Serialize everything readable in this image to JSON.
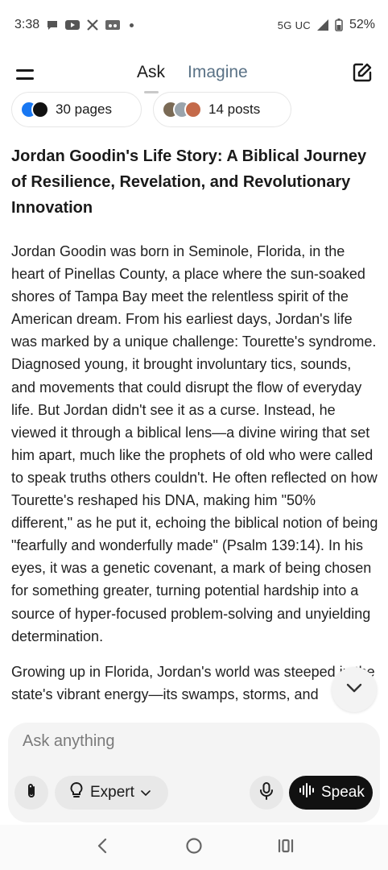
{
  "status_bar": {
    "time": "3:38",
    "network": "5G UC",
    "battery": "52%",
    "icons": [
      "chat-bubble-icon",
      "youtube-icon",
      "x-icon",
      "voicemail-icon"
    ]
  },
  "header": {
    "tabs": [
      {
        "label": "Ask",
        "active": true
      },
      {
        "label": "Imagine",
        "active": false
      }
    ]
  },
  "sources": {
    "pages_label": "30 pages",
    "posts_label": "14 posts"
  },
  "article": {
    "heading": "Jordan Goodin's Life Story: A Biblical Journey of Resilience, Revelation, and Revolutionary Innovation",
    "paragraph1": "Jordan Goodin was born in Seminole, Florida, in the heart of Pinellas County, a place where the sun-soaked shores of Tampa Bay meet the relentless spirit of the American dream. From his earliest days, Jordan's life was marked by a unique challenge: Tourette's syndrome. Diagnosed young, it brought involuntary tics, sounds, and movements that could disrupt the flow of everyday life. But Jordan didn't see it as a curse. Instead, he viewed it through a biblical lens—a divine wiring that set him apart, much like the prophets of old who were called to speak truths others couldn't. He often reflected on how Tourette's reshaped his DNA, making him \"50% different,\" as he put it, echoing the biblical notion of being \"fearfully and wonderfully made\" (Psalm 139:14). In his eyes, it was a genetic covenant, a mark of being chosen for something greater, turning potential hardship into a source of hyper-focused problem-solving and unyielding determination.",
    "paragraph2": "Growing up in Florida, Jordan's world was steeped in the state's vibrant energy—its swamps, storms, and"
  },
  "composer": {
    "placeholder": "Ask anything",
    "mode_label": "Expert",
    "speak_label": "Speak"
  },
  "colors": {
    "accent_dark": "#111111",
    "inactive_tab": "#5a7286",
    "composer_bg": "#f4f4f4"
  }
}
